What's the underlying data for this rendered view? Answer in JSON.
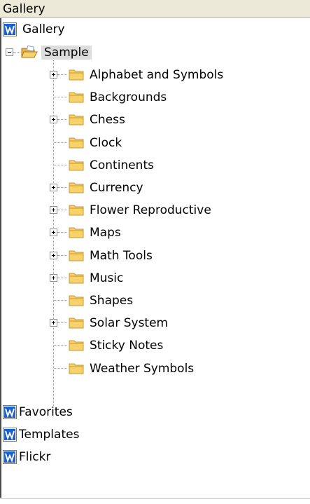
{
  "header": {
    "title": "Gallery"
  },
  "tree": {
    "roots": [
      {
        "label": "Gallery",
        "icon": "gallery-logo-icon"
      },
      {
        "label": "Favorites",
        "icon": "gallery-logo-icon"
      },
      {
        "label": "Templates",
        "icon": "gallery-logo-icon"
      },
      {
        "label": "Flickr",
        "icon": "gallery-logo-icon"
      }
    ],
    "sample": {
      "label": "Sample",
      "icon": "open-folder-icon",
      "expanded": true
    },
    "folders": [
      {
        "label": "Alphabet and Symbols",
        "expandable": true
      },
      {
        "label": "Backgrounds",
        "expandable": false
      },
      {
        "label": "Chess",
        "expandable": true
      },
      {
        "label": "Clock",
        "expandable": false
      },
      {
        "label": "Continents",
        "expandable": false
      },
      {
        "label": "Currency",
        "expandable": true
      },
      {
        "label": "Flower Reproductive",
        "expandable": true
      },
      {
        "label": "Maps",
        "expandable": true
      },
      {
        "label": "Math Tools",
        "expandable": true
      },
      {
        "label": "Music",
        "expandable": true
      },
      {
        "label": "Shapes",
        "expandable": false
      },
      {
        "label": "Solar System",
        "expandable": true
      },
      {
        "label": "Sticky Notes",
        "expandable": false
      },
      {
        "label": "Weather Symbols",
        "expandable": false
      }
    ]
  },
  "colors": {
    "header_bg": "#ece9d8",
    "logo_blue": "#1c5fd1",
    "folder_yellow": "#f6d26a",
    "folder_edge": "#c8962c"
  }
}
